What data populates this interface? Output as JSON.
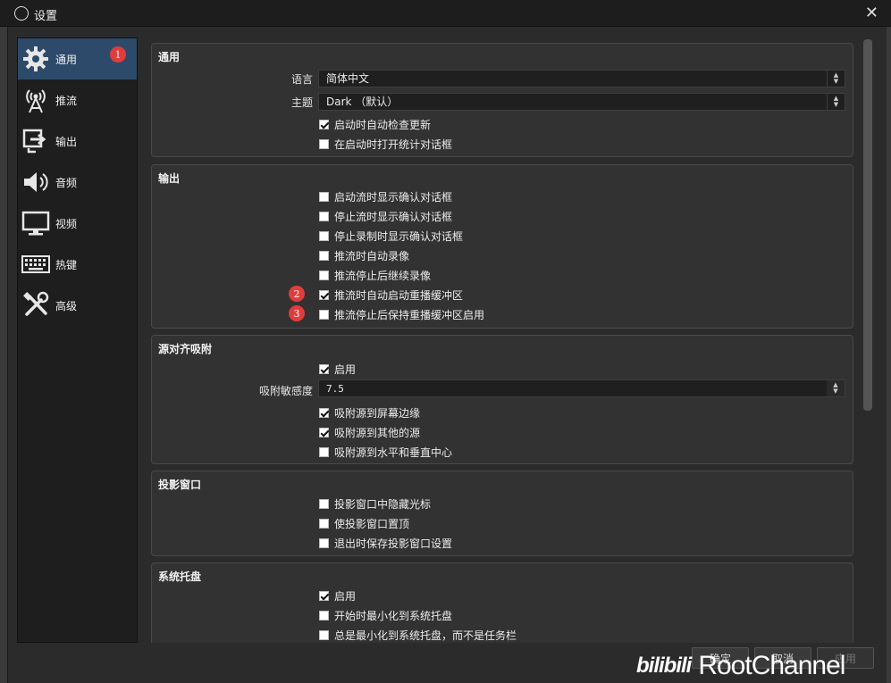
{
  "window": {
    "title": "设置",
    "close_label": "✕"
  },
  "sidebar": {
    "items": [
      {
        "label": "通用",
        "icon": "gear-icon",
        "active": true
      },
      {
        "label": "推流",
        "icon": "antenna-icon"
      },
      {
        "label": "输出",
        "icon": "output-icon"
      },
      {
        "label": "音频",
        "icon": "speaker-icon"
      },
      {
        "label": "视频",
        "icon": "monitor-icon"
      },
      {
        "label": "热键",
        "icon": "keyboard-icon"
      },
      {
        "label": "高级",
        "icon": "tools-icon"
      }
    ]
  },
  "badges": {
    "one": "1",
    "two": "2",
    "three": "3"
  },
  "groups": {
    "general": {
      "title": "通用",
      "language_label": "语言",
      "language_value": "简体中文",
      "theme_label": "主题",
      "theme_value": "Dark （默认）",
      "check_updates": "启动时自动检查更新",
      "stats_dialog": "在启动时打开统计对话框"
    },
    "output": {
      "title": "输出",
      "items": [
        "启动流时显示确认对话框",
        "停止流时显示确认对话框",
        "停止录制时显示确认对话框",
        "推流时自动录像",
        "推流停止后继续录像",
        "推流时自动启动重播缓冲区",
        "推流停止后保持重播缓冲区启用"
      ]
    },
    "snapping": {
      "title": "源对齐吸附",
      "enable": "启用",
      "sensitivity_label": "吸附敏感度",
      "sensitivity_value": "7.5",
      "items": [
        "吸附源到屏幕边缘",
        "吸附源到其他的源",
        "吸附源到水平和垂直中心"
      ]
    },
    "projector": {
      "title": "投影窗口",
      "items": [
        "投影窗口中隐藏光标",
        "使投影窗口置顶",
        "退出时保存投影窗口设置"
      ]
    },
    "tray": {
      "title": "系统托盘",
      "items": [
        "启用",
        "开始时最小化到系统托盘",
        "总是最小化到系统托盘，而不是任务栏"
      ]
    }
  },
  "buttons": {
    "ok": "确定",
    "cancel": "取消",
    "apply": "应用"
  },
  "watermark": {
    "brand": "bilibili",
    "channel": "RootChannel"
  }
}
